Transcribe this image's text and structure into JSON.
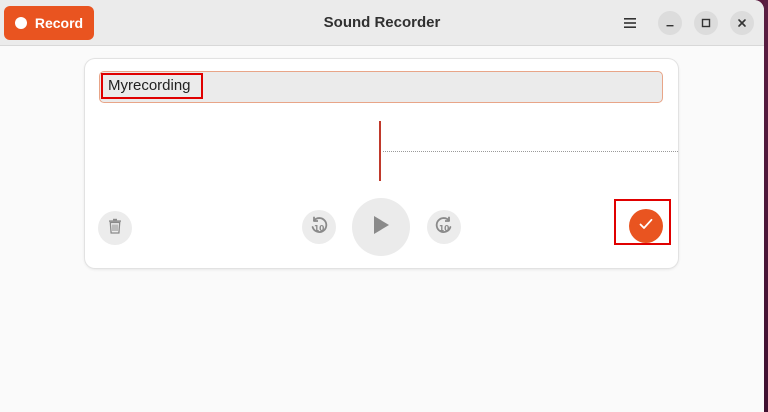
{
  "window": {
    "title": "Sound Recorder"
  },
  "header": {
    "record_label": "Record",
    "menu_icon": "hamburger-menu-icon",
    "minimize_icon": "minimize-icon",
    "maximize_icon": "maximize-icon",
    "close_icon": "close-icon"
  },
  "recording": {
    "name_value": "Myrecording",
    "delete_icon": "trash-icon",
    "rewind_icon": "rewind-10-icon",
    "play_icon": "play-icon",
    "forward_icon": "forward-10-icon",
    "done_icon": "checkmark-icon"
  },
  "colors": {
    "accent": "#e95420",
    "playhead": "#c0392b",
    "highlight": "#e00000"
  }
}
